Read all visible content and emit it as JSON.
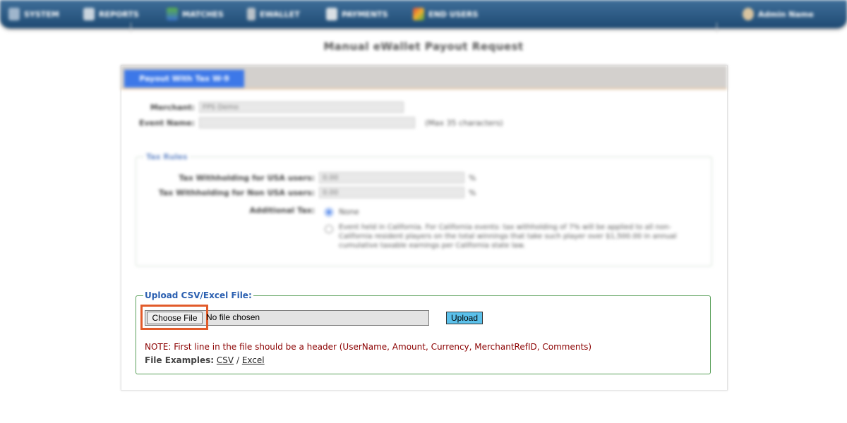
{
  "nav": {
    "items": [
      {
        "label": "SYSTEM",
        "icon": "system-icon"
      },
      {
        "label": "REPORTS",
        "icon": "reports-icon"
      },
      {
        "label": "MATCHES",
        "icon": "matches-icon"
      },
      {
        "label": "EWALLET",
        "icon": "ewallet-icon"
      },
      {
        "label": "PAYMENTS",
        "icon": "payments-icon"
      },
      {
        "label": "END USERS",
        "icon": "end-users-icon"
      }
    ],
    "user_label": "Admin Name"
  },
  "page": {
    "title": "Manual eWallet Payout Request"
  },
  "tab": {
    "label": "Payout With Tax W-9"
  },
  "form": {
    "merchant_label": "Merchant:",
    "merchant_value": "FPS Demo",
    "event_label": "Event Name:",
    "event_hint": "(Max 35 characters)"
  },
  "tax": {
    "legend": "Tax Rules",
    "usa_label": "Tax Withholding for USA users:",
    "usa_value": "0.00",
    "non_usa_label": "Tax Withholding for Non USA users:",
    "non_usa_value": "0.00",
    "percent": "%",
    "additional_label": "Additional Tax:",
    "option_none": "None",
    "option_ca": "Event held in California. For California events: tax withholding of 7% will be applied to all non-California resident players on the total winnings that take such player over $1,500.00 in annual cumulative taxable earnings per California state law."
  },
  "upload": {
    "legend": "Upload CSV/Excel File:",
    "choose_label": "Choose File",
    "no_file": "No file chosen",
    "upload_label": "Upload",
    "note": "NOTE: First line in the file should be a header (UserName, Amount, Currency, MerchantRefID, Comments)",
    "examples_label": "File Examples:",
    "csv_label": "CSV",
    "slash": "/",
    "excel_label": "Excel"
  },
  "colors": {
    "nav_bar": "#2a5a87",
    "tab_active": "#3d78e8",
    "upload_border": "#5aa05a",
    "upload_legend": "#2a5fb0",
    "note_text": "#8b0000",
    "upload_button": "#5bc0ea",
    "highlight": "#e25b2a"
  }
}
